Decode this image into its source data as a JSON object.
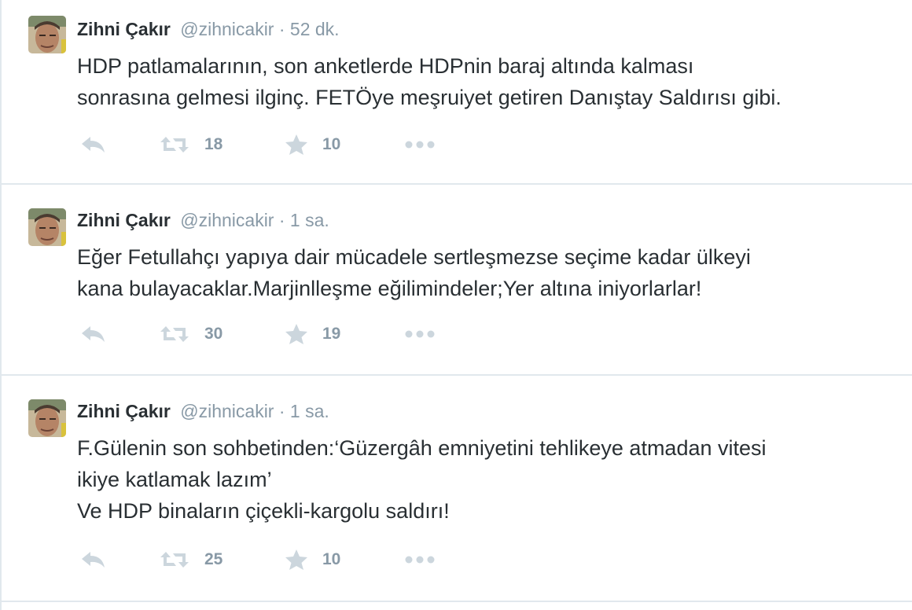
{
  "tweets": [
    {
      "fullname": "Zihni Çakır",
      "username": "@zihnicakir",
      "separator": "·",
      "time": "52 dk.",
      "lines": [
        "HDP patlamalarının, son anketlerde HDPnin baraj altında kalması",
        "sonrasına gelmesi ilginç. FETÖye meşruiyet getiren Danıştay Saldırısı gibi."
      ],
      "retweets": "18",
      "favorites": "10"
    },
    {
      "fullname": "Zihni Çakır",
      "username": "@zihnicakir",
      "separator": "·",
      "time": "1 sa.",
      "lines": [
        "Eğer Fetullahçı yapıya dair mücadele sertleşmezse seçime kadar ülkeyi",
        "kana bulayacaklar.Marjinlleşme eğilimindeler;Yer altına iniyorlarlar!"
      ],
      "retweets": "30",
      "favorites": "19"
    },
    {
      "fullname": "Zihni Çakır",
      "username": "@zihnicakir",
      "separator": "·",
      "time": "1 sa.",
      "lines": [
        "F.Gülenin son sohbetinden:‘Güzergâh emniyetini tehlikeye atmadan vitesi",
        "ikiye katlamak lazım’",
        "Ve HDP binaların çiçekli-kargolu saldırı!"
      ],
      "retweets": "25",
      "favorites": "10"
    }
  ],
  "icons": {
    "reply": "reply-icon",
    "retweet": "retweet-icon",
    "favorite": "star-icon",
    "more": "more-dots-icon"
  },
  "colors": {
    "text": "#292f33",
    "muted": "#8899a6",
    "icon": "#ccd6dd",
    "divider": "#e1e8ed"
  }
}
